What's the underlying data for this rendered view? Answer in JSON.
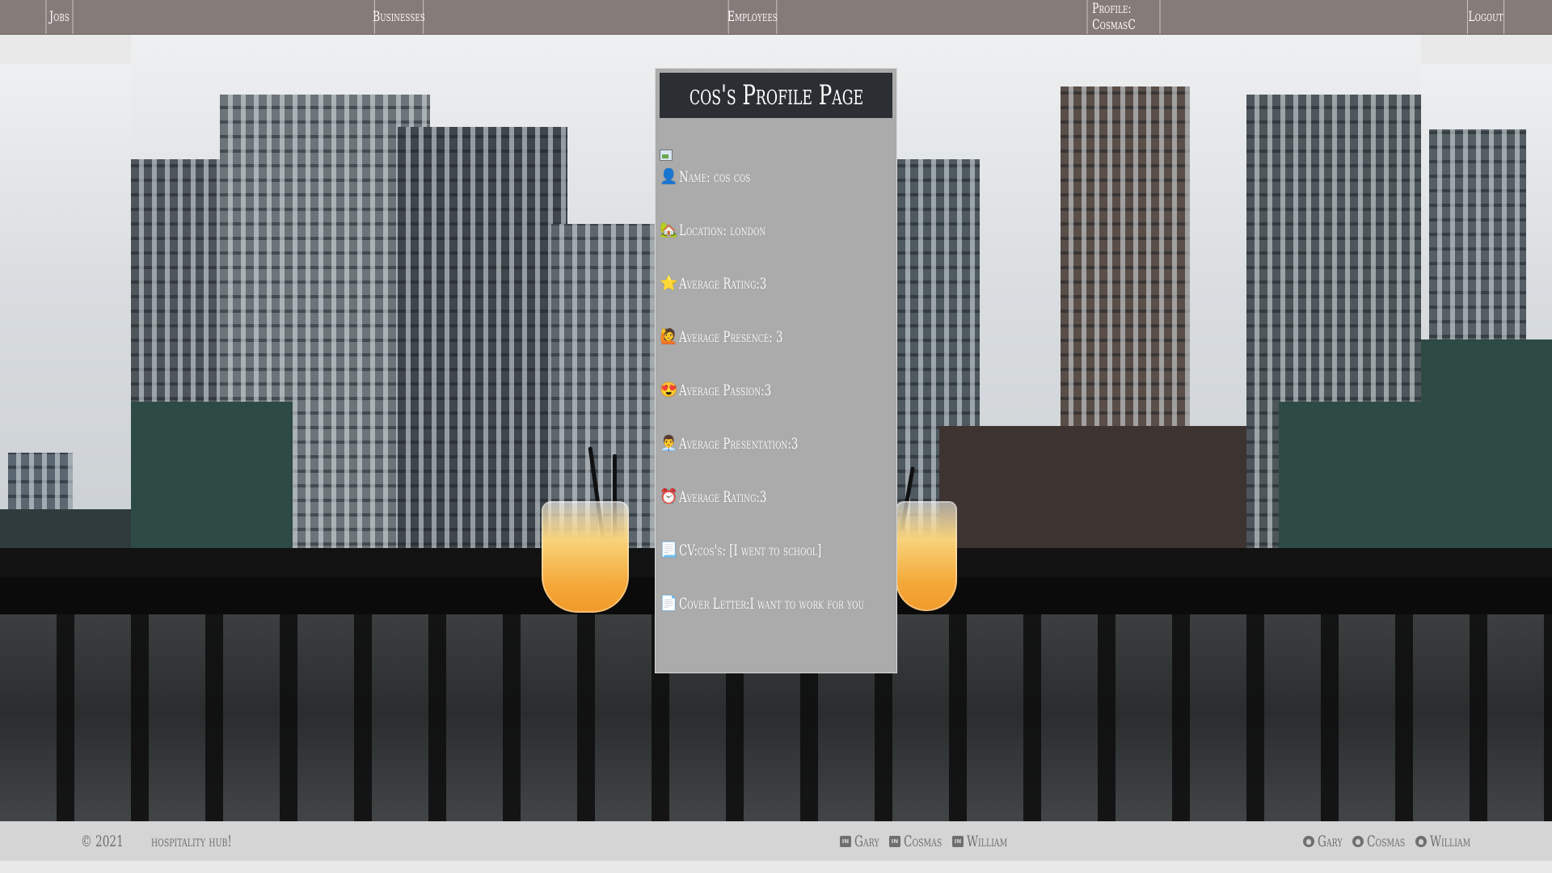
{
  "nav": {
    "jobs": "Jobs",
    "businesses": "Businesses",
    "employees": "Employees",
    "profile": "Profile: CosmasC",
    "logout": "Logout"
  },
  "profile": {
    "title": "cos's Profile Page",
    "fields": [
      {
        "icon": "👤",
        "icon_name": "person-icon",
        "text": "Name: cos cos"
      },
      {
        "icon": "🏡",
        "icon_name": "house-icon",
        "text": "Location: london"
      },
      {
        "icon": "⭐",
        "icon_name": "star-icon",
        "text": "Average Rating:3"
      },
      {
        "icon": "🙋",
        "icon_name": "raised-hand-icon",
        "text": "Average Presence: 3"
      },
      {
        "icon": "😍",
        "icon_name": "heart-eyes-icon",
        "text": "Average Passion:3"
      },
      {
        "icon": "👨‍💼",
        "icon_name": "office-worker-icon",
        "text": "Average Presentation:3"
      },
      {
        "icon": "⏰",
        "icon_name": "alarm-clock-icon",
        "text": "Average Rating:3"
      },
      {
        "icon": "📃",
        "icon_name": "page-curl-icon",
        "text": "CV:cos's: [I went to school]"
      },
      {
        "icon": "📄",
        "icon_name": "page-icon",
        "text": "Cover Letter:I want to work for you"
      }
    ]
  },
  "footer": {
    "copyright": "© 2021",
    "brand": "hospitality hub!",
    "linkedin": [
      "Gary",
      "Cosmas",
      "William"
    ],
    "github": [
      "Gary",
      "Cosmas",
      "William"
    ]
  },
  "colors": {
    "nav_bg": "#857b79",
    "card_bg": "#ababab",
    "title_bg": "#2b2e33",
    "footer_bg": "#d5d5d5",
    "footer_text": "#6f6f6f"
  }
}
